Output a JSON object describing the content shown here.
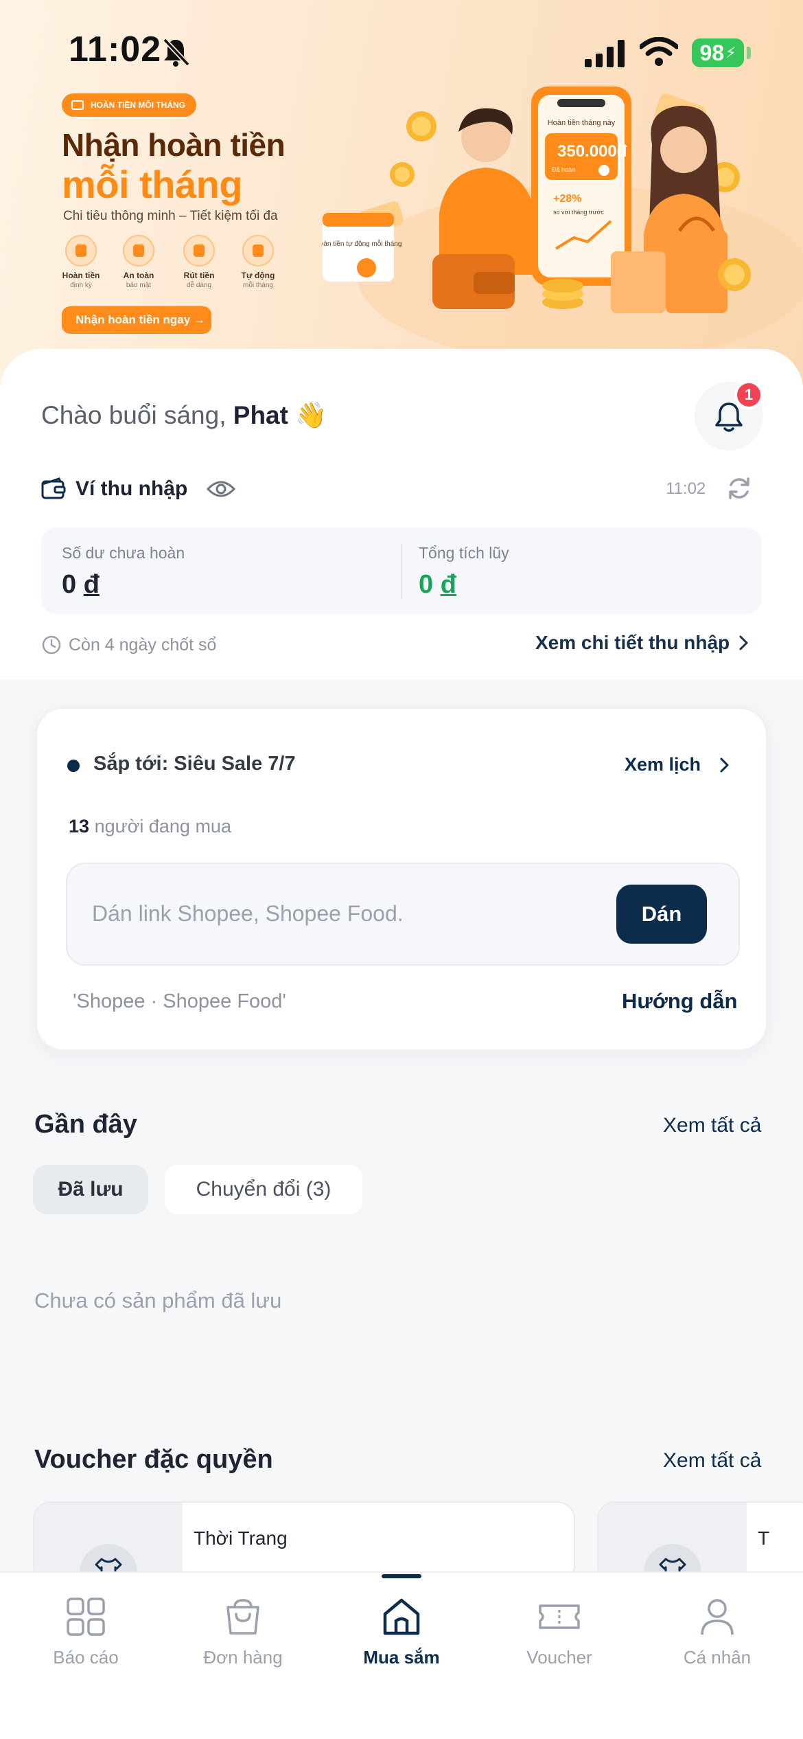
{
  "status_bar": {
    "time": "11:02",
    "battery": "98"
  },
  "banner": {
    "pill": "HOÀN TIỀN MỖI THÁNG",
    "headline_1": "Nhận hoàn tiền",
    "headline_2": "mỗi tháng",
    "subtitle": "Chi tiêu thông minh – Tiết kiệm tối đa",
    "features": [
      {
        "title": "Hoàn tiền",
        "sub": "định kỳ"
      },
      {
        "title": "An toàn",
        "sub": "bảo mật"
      },
      {
        "title": "Rút tiền",
        "sub": "dễ dàng"
      },
      {
        "title": "Tự động",
        "sub": "mỗi tháng"
      }
    ],
    "cta": "Nhận hoàn tiền ngay →",
    "phone_title": "Hoàn tiền tháng này",
    "phone_amount": "350.000",
    "phone_status": "Đã hoàn",
    "phone_growth": "+28%",
    "phone_growth_note": "so với tháng trước",
    "calendar_text": "Hoàn tiền tự động mỗi tháng"
  },
  "greeting": {
    "prefix": "Chào buổi sáng,",
    "name": "Phat",
    "emoji": "👋"
  },
  "notifications": {
    "count": "1"
  },
  "wallet": {
    "title": "Ví thu nhập",
    "updated_time": "11:02",
    "pending_label": "Số dư chưa hoàn",
    "pending_value": "0",
    "total_label": "Tổng tích lũy",
    "total_value": "0",
    "currency": "đ",
    "countdown": "Còn 4 ngày chốt sổ",
    "details_link": "Xem chi tiết thu nhập"
  },
  "sale": {
    "title": "Sắp tới: Siêu Sale 7/7",
    "schedule_link": "Xem lịch",
    "buyers_count": "13",
    "buyers_text": "người đang mua",
    "input_placeholder": "Dán link Shopee, Shopee Food.",
    "paste_button": "Dán",
    "platforms": "'Shopee · Shopee Food'",
    "guide_link": "Hướng dẫn"
  },
  "recent": {
    "title": "Gần đây",
    "see_all": "Xem tất cả",
    "tabs": [
      "Đã lưu",
      "Chuyển đổi (3)"
    ],
    "empty": "Chưa có sản phẩm đã lưu"
  },
  "vouchers": {
    "title": "Voucher đặc quyền",
    "see_all": "Xem tất cả",
    "items": [
      {
        "name": "Thời Trang"
      },
      {
        "name": "T"
      }
    ]
  },
  "tab_bar": {
    "items": [
      {
        "label": "Báo cáo",
        "icon": "grid-icon"
      },
      {
        "label": "Đơn hàng",
        "icon": "bag-icon"
      },
      {
        "label": "Mua sắm",
        "icon": "home-icon"
      },
      {
        "label": "Voucher",
        "icon": "ticket-icon"
      },
      {
        "label": "Cá nhân",
        "icon": "user-icon"
      }
    ],
    "active": "Mua sắm"
  },
  "colors": {
    "primary": "#0d2b4a",
    "accent": "#ff8c1a",
    "positive": "#1aa35a",
    "badge": "#f04454"
  }
}
